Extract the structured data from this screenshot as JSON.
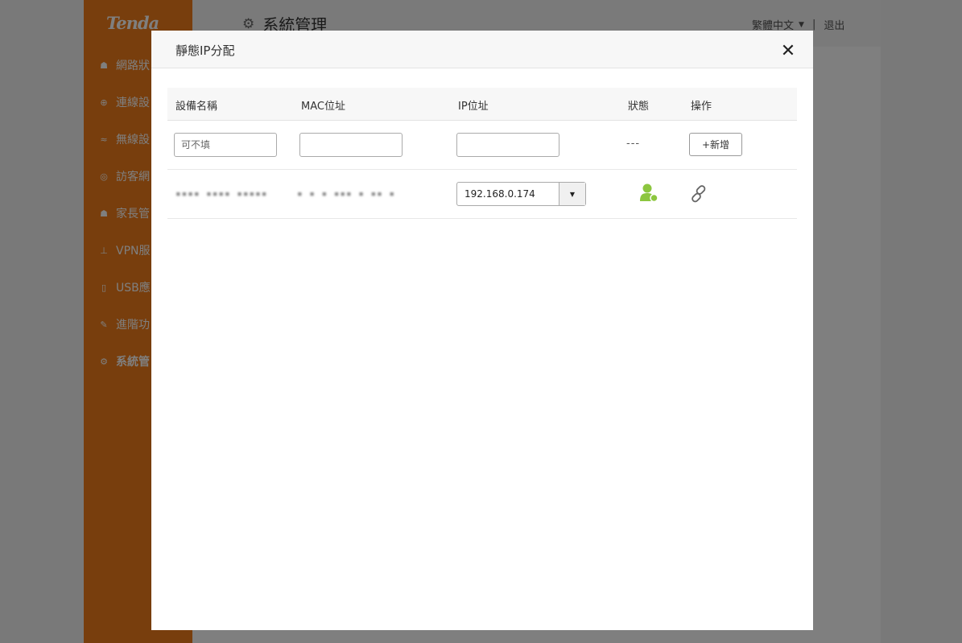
{
  "app": {
    "logo": "Tenda",
    "page_title": "系統管理",
    "page_title_icon": "gear-icon",
    "language": "繁體中文",
    "separator": "|",
    "logout": "退出"
  },
  "sidebar": {
    "items": [
      {
        "label": "網路狀",
        "icon": "network-status-icon",
        "glyph": "☗"
      },
      {
        "label": "連線設",
        "icon": "globe-icon",
        "glyph": "⊕"
      },
      {
        "label": "無線設",
        "icon": "wifi-icon",
        "glyph": "≈"
      },
      {
        "label": "訪客網",
        "icon": "guest-icon",
        "glyph": "◎"
      },
      {
        "label": "家長管",
        "icon": "parental-icon",
        "glyph": "☗"
      },
      {
        "label": "VPN服",
        "icon": "vpn-icon",
        "glyph": "⊥"
      },
      {
        "label": "USB應",
        "icon": "usb-icon",
        "glyph": "▯"
      },
      {
        "label": "進階功",
        "icon": "wrench-icon",
        "glyph": "✎"
      },
      {
        "label": "系統管",
        "icon": "gear-icon",
        "glyph": "⚙",
        "active": true
      }
    ]
  },
  "modal": {
    "title": "靜態IP分配",
    "close_icon": "close-icon",
    "columns": {
      "device_name": "設備名稱",
      "mac": "MAC位址",
      "ip": "IP位址",
      "status": "狀態",
      "action": "操作"
    },
    "new_row": {
      "device_name_placeholder": "可不填",
      "device_name_value": "",
      "mac_value": "",
      "ip_value": "",
      "status": "---",
      "add_label": "+新增"
    },
    "rows": [
      {
        "device_name": "▪▪▪▪ ▪▪▪▪ ▪▪▪▪▪",
        "mac": "▪ ▪ ▪ ▪▪▪ ▪ ▪▪ ▪",
        "ip": "192.168.0.174",
        "status_icon": "user-online-icon",
        "action_icon": "link-icon"
      }
    ]
  },
  "colors": {
    "sidebar": "#f07d1a",
    "status_green": "#8cc63f",
    "overlay": "rgba(0,0,0,0.5)"
  }
}
